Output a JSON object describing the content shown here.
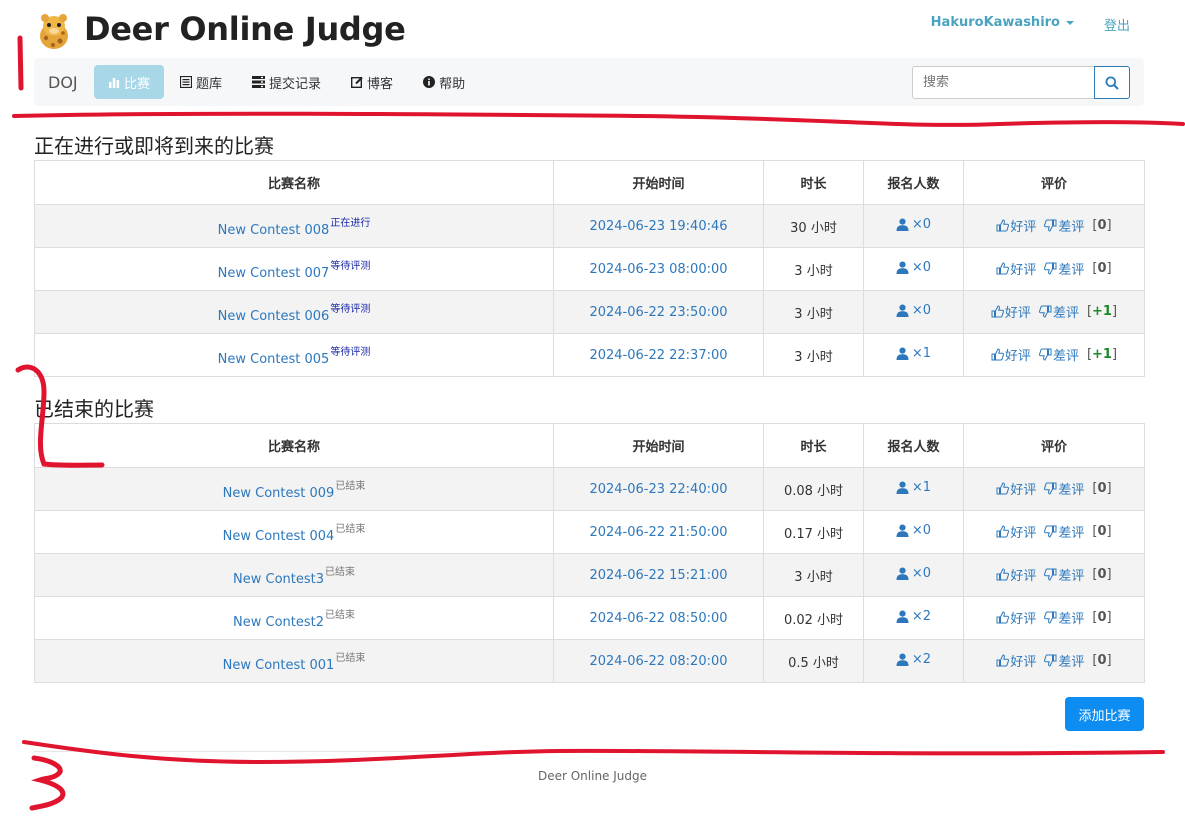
{
  "header": {
    "site_title": "Deer Online Judge",
    "user": "HakuroKawashiro",
    "logout": "登出"
  },
  "nav": {
    "brand": "DOJ",
    "items": [
      {
        "label": "比赛",
        "icon": "bar-chart-icon",
        "active": true
      },
      {
        "label": "题库",
        "icon": "list-icon",
        "active": false
      },
      {
        "label": "提交记录",
        "icon": "tasks-icon",
        "active": false
      },
      {
        "label": "博客",
        "icon": "edit-icon",
        "active": false
      },
      {
        "label": "帮助",
        "icon": "info-icon",
        "active": false
      }
    ],
    "search_placeholder": "搜索"
  },
  "table_headers": [
    "比赛名称",
    "开始时间",
    "时长",
    "报名人数",
    "评价"
  ],
  "rate_labels": {
    "good": "好评",
    "bad": "差评"
  },
  "upcoming": {
    "title": "正在进行或即将到来的比赛",
    "rows": [
      {
        "name": "New Contest 008",
        "status": "正在进行",
        "start": "2024-06-23 19:40:46",
        "duration": "30 小时",
        "count": "×0",
        "score": "0"
      },
      {
        "name": "New Contest 007",
        "status": "等待评测",
        "start": "2024-06-23 08:00:00",
        "duration": "3 小时",
        "count": "×0",
        "score": "0"
      },
      {
        "name": "New Contest 006",
        "status": "等待评测",
        "start": "2024-06-22 23:50:00",
        "duration": "3 小时",
        "count": "×0",
        "score": "+1"
      },
      {
        "name": "New Contest 005",
        "status": "等待评测",
        "start": "2024-06-22 22:37:00",
        "duration": "3 小时",
        "count": "×1",
        "score": "+1"
      }
    ]
  },
  "finished": {
    "title": "已结束的比赛",
    "rows": [
      {
        "name": "New Contest 009",
        "status": "已结束",
        "start": "2024-06-23 22:40:00",
        "duration": "0.08 小时",
        "count": "×1",
        "score": "0"
      },
      {
        "name": "New Contest 004",
        "status": "已结束",
        "start": "2024-06-22 21:50:00",
        "duration": "0.17 小时",
        "count": "×0",
        "score": "0"
      },
      {
        "name": "New Contest3",
        "status": "已结束",
        "start": "2024-06-22 15:21:00",
        "duration": "3 小时",
        "count": "×0",
        "score": "0"
      },
      {
        "name": "New Contest2",
        "status": "已结束",
        "start": "2024-06-22 08:50:00",
        "duration": "0.02 小时",
        "count": "×2",
        "score": "0"
      },
      {
        "name": "New Contest 001",
        "status": "已结束",
        "start": "2024-06-22 08:20:00",
        "duration": "0.5 小时",
        "count": "×2",
        "score": "0"
      }
    ]
  },
  "add_button": "添加比赛",
  "footer": "Deer Online Judge",
  "colors": {
    "link": "#2d78bd",
    "accent": "#a8d8e8",
    "primary_button": "#0d8cf2",
    "annotation": "#e0142e"
  }
}
